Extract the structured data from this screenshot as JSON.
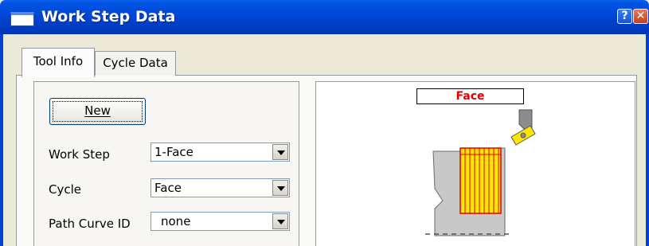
{
  "window": {
    "title": "Work Step Data"
  },
  "tabs": [
    {
      "label": "Tool Info",
      "active": true
    },
    {
      "label": "Cycle Data",
      "active": false
    }
  ],
  "tool_info": {
    "new_button_label": "New",
    "fields": [
      {
        "label": "Work Step",
        "value": "1-Face"
      },
      {
        "label": "Cycle",
        "value": "Face"
      },
      {
        "label": "Path Curve ID",
        "value": "none"
      }
    ]
  },
  "preview": {
    "label": "Face"
  },
  "colors": {
    "title_bar": "#0042d3",
    "preview_label": "#e00000",
    "cut_region_fill": "#ffe600",
    "cut_region_border": "#e00000",
    "stock": "#c0c0c0",
    "tool": "#808080"
  },
  "icons": [
    "window-icon",
    "help-icon",
    "close-icon",
    "dropdown-arrow-icon"
  ]
}
